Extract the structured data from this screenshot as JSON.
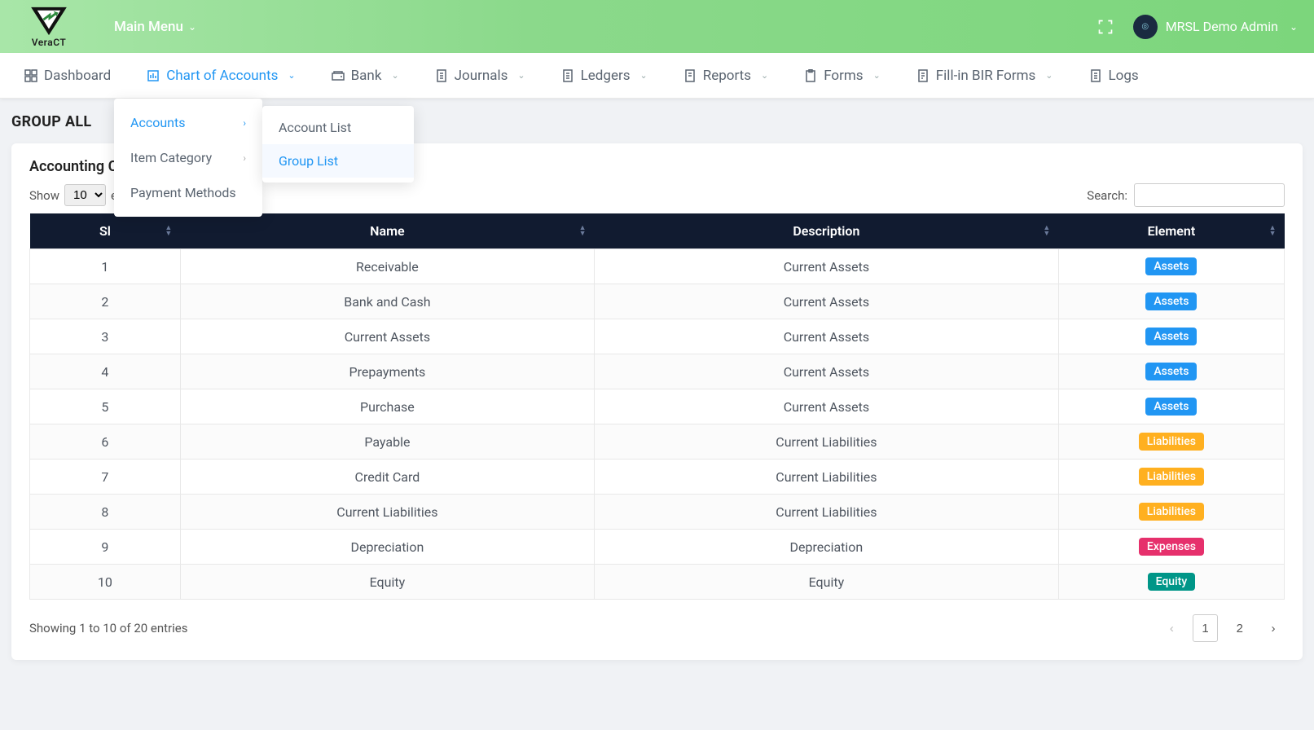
{
  "brand": {
    "name": "VeraCT"
  },
  "topbar": {
    "main_menu_label": "Main Menu",
    "user_name": "MRSL Demo Admin"
  },
  "nav": {
    "items": [
      {
        "label": "Dashboard",
        "has_chev": false
      },
      {
        "label": "Chart of Accounts",
        "has_chev": true,
        "active": true
      },
      {
        "label": "Bank",
        "has_chev": true
      },
      {
        "label": "Journals",
        "has_chev": true
      },
      {
        "label": "Ledgers",
        "has_chev": true
      },
      {
        "label": "Reports",
        "has_chev": true
      },
      {
        "label": "Forms",
        "has_chev": true
      },
      {
        "label": "Fill-in BIR Forms",
        "has_chev": true
      },
      {
        "label": "Logs",
        "has_chev": false
      }
    ]
  },
  "dropdown": {
    "items": [
      {
        "label": "Accounts",
        "has_arrow": true,
        "active": true
      },
      {
        "label": "Item Category",
        "has_arrow": true
      },
      {
        "label": "Payment Methods",
        "has_arrow": false
      }
    ],
    "submenu": [
      {
        "label": "Account List"
      },
      {
        "label": "Group List",
        "active": true
      }
    ]
  },
  "page": {
    "title": "GROUP ALL",
    "card_heading": "Accounting Categories"
  },
  "table": {
    "show_label_pre": "Show",
    "show_label_post": "entries",
    "page_size": "10",
    "search_label": "Search:",
    "columns": [
      "Sl",
      "Name",
      "Description",
      "Element"
    ],
    "rows": [
      {
        "sl": "1",
        "name": "Receivable",
        "desc": "Current Assets",
        "element": "Assets"
      },
      {
        "sl": "2",
        "name": "Bank and Cash",
        "desc": "Current Assets",
        "element": "Assets"
      },
      {
        "sl": "3",
        "name": "Current Assets",
        "desc": "Current Assets",
        "element": "Assets"
      },
      {
        "sl": "4",
        "name": "Prepayments",
        "desc": "Current Assets",
        "element": "Assets"
      },
      {
        "sl": "5",
        "name": "Purchase",
        "desc": "Current Assets",
        "element": "Assets"
      },
      {
        "sl": "6",
        "name": "Payable",
        "desc": "Current Liabilities",
        "element": "Liabilities"
      },
      {
        "sl": "7",
        "name": "Credit Card",
        "desc": "Current Liabilities",
        "element": "Liabilities"
      },
      {
        "sl": "8",
        "name": "Current Liabilities",
        "desc": "Current Liabilities",
        "element": "Liabilities"
      },
      {
        "sl": "9",
        "name": "Depreciation",
        "desc": "Depreciation",
        "element": "Expenses"
      },
      {
        "sl": "10",
        "name": "Equity",
        "desc": "Equity",
        "element": "Equity"
      }
    ],
    "info": "Showing 1 to 10 of 20 entries",
    "pages": [
      "1",
      "2"
    ],
    "current_page": "1"
  }
}
